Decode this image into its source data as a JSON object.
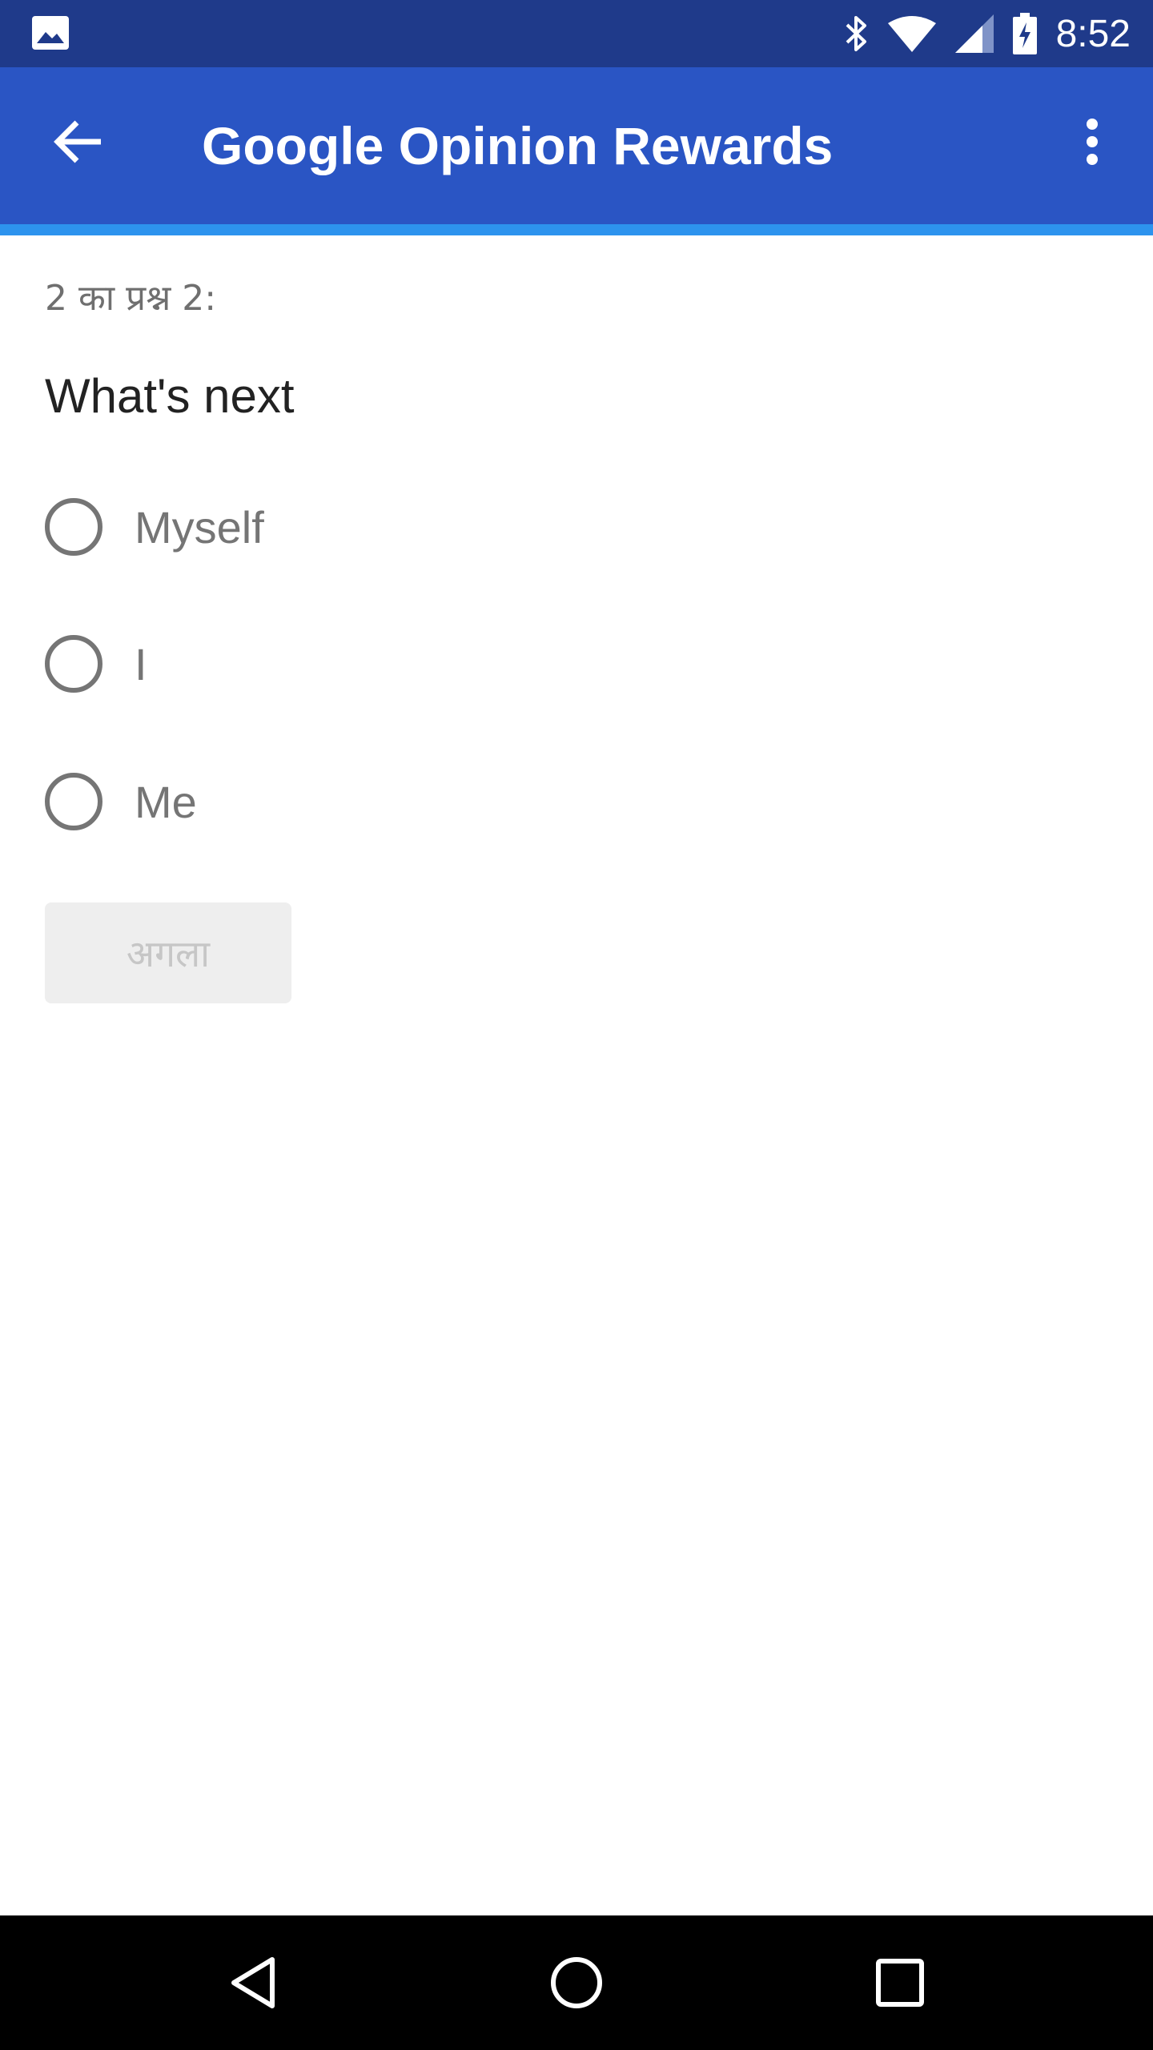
{
  "status_bar": {
    "time": "8:52",
    "icons": [
      "gallery-notification-icon",
      "bluetooth-icon",
      "wifi-icon",
      "cellular-signal-icon",
      "battery-charging-icon"
    ]
  },
  "app_bar": {
    "title": "Google Opinion Rewards",
    "back_icon": "arrow-back-icon",
    "menu_icon": "more-vert-icon"
  },
  "survey": {
    "counter": "2 का प्रश्न 2:",
    "question": "What's next",
    "options": [
      {
        "label": "Myself",
        "selected": false
      },
      {
        "label": "I",
        "selected": false
      },
      {
        "label": "Me",
        "selected": false
      }
    ],
    "next_label": "अगला",
    "next_enabled": false
  },
  "nav_bar": {
    "icons": [
      "back-triangle-icon",
      "home-circle-icon",
      "recents-square-icon"
    ]
  },
  "colors": {
    "status_bar": "#1f3a8a",
    "app_bar": "#2a55c4",
    "accent_underline": "#2d93ee",
    "radio_border": "#757575",
    "disabled_button": "#eeeeee"
  }
}
